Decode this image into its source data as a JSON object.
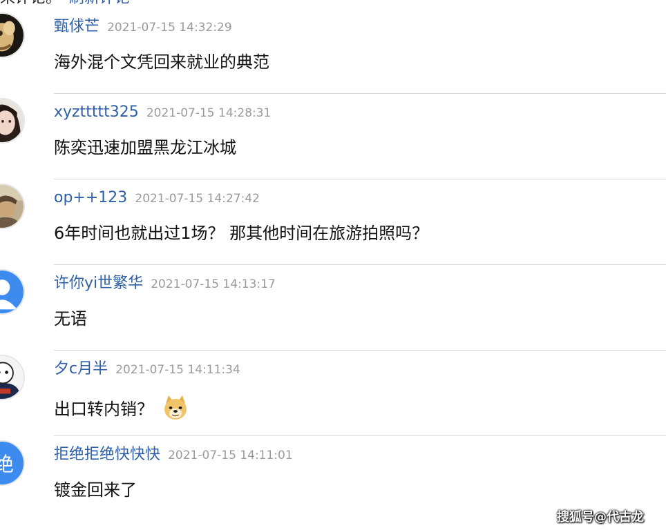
{
  "top_strip": {
    "tail_text": "来评论。",
    "refresh_label": "刷新评论"
  },
  "comments": [
    {
      "username": "甄俅芒",
      "time": "2021-07-15 14:32:29",
      "text": "海外混个文凭回来就业的典范",
      "avatar_icon": "avatar-dark-yellow-icon"
    },
    {
      "username": "xyzttttt325",
      "time": "2021-07-15 14:28:31",
      "text": "陈奕迅速加盟黑龙江冰城",
      "avatar_icon": "avatar-portrait-icon"
    },
    {
      "username": "op++123",
      "time": "2021-07-15 14:27:42",
      "text": "6年时间也就出过1场？ 那其他时间在旅游拍照吗？",
      "avatar_icon": "avatar-sepia-portrait-icon"
    },
    {
      "username": "许你yi世繁华",
      "time": "2021-07-15 14:13:17",
      "text": "无语",
      "avatar_icon": "avatar-blue-default-icon"
    },
    {
      "username": "夕c月半",
      "time": "2021-07-15 14:11:34",
      "text": "出口转内销？",
      "avatar_icon": "avatar-cartoon-icon",
      "emoji": "doge-emoji-icon"
    },
    {
      "username": "拒绝拒绝快快快",
      "time": "2021-07-15 14:11:01",
      "text": "镀金回来了",
      "avatar_icon": "avatar-blue-initial-icon",
      "avatar_initial": "绝"
    }
  ],
  "watermark": "搜狐号@代古龙",
  "colors": {
    "username": "#2f5fa7",
    "time": "#9a9a9a",
    "text": "#111111",
    "divider": "#d8d8d8",
    "avatar_blue": "#3d8bef"
  }
}
